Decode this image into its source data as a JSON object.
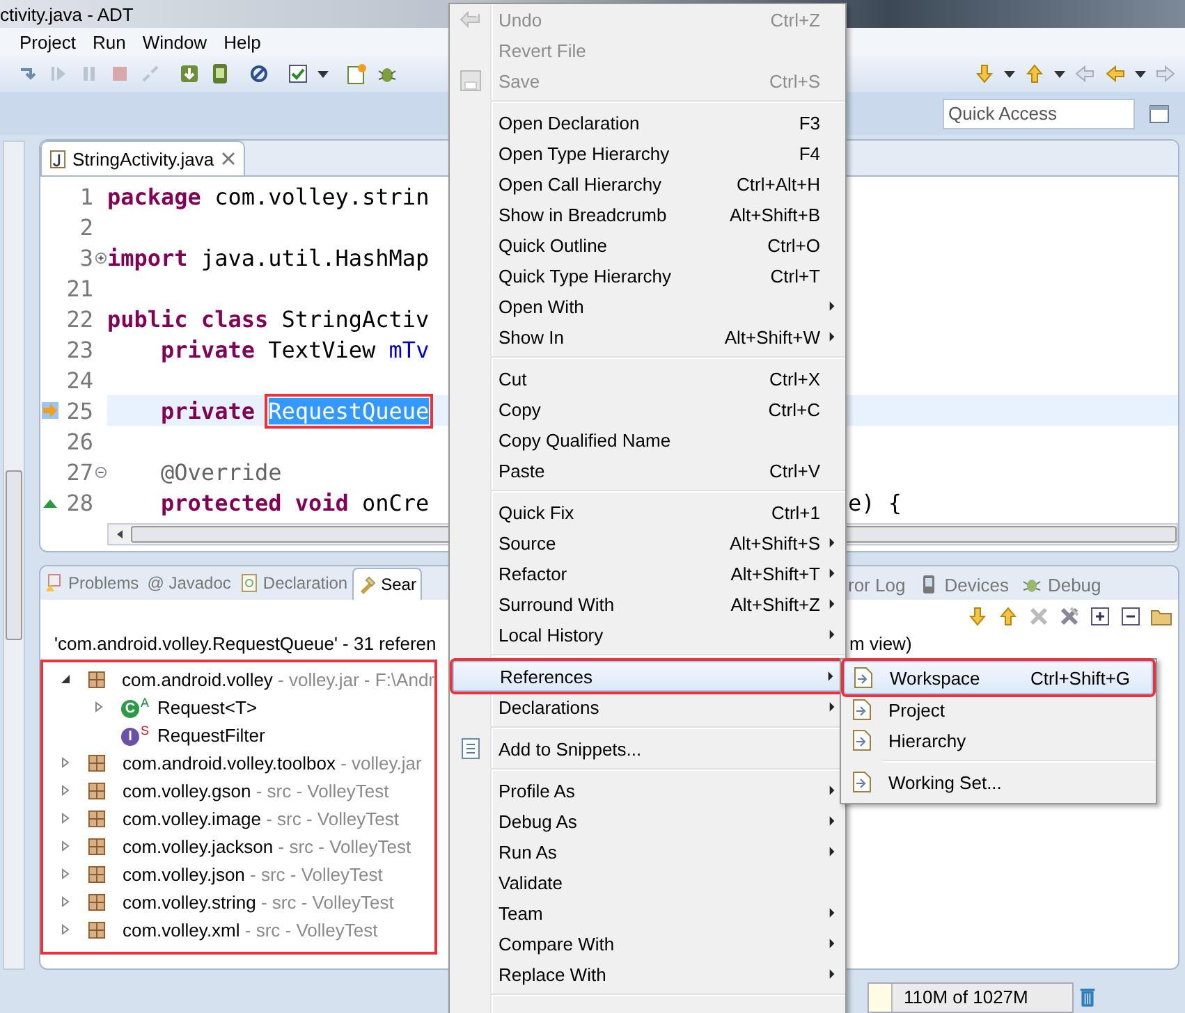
{
  "window": {
    "title": "ctivity.java - ADT"
  },
  "menubar": [
    "Project",
    "Run",
    "Window",
    "Help"
  ],
  "quick_access": {
    "placeholder": "Quick Access"
  },
  "editor": {
    "tab": {
      "label": "StringActivity.java",
      "selected": true
    },
    "lines": [
      {
        "number": "1",
        "tokens": [
          {
            "kind": "keyword",
            "text": "package"
          },
          {
            "kind": "plain",
            "text": " com.volley.strin"
          }
        ]
      },
      {
        "number": "2"
      },
      {
        "number": "3",
        "collapsed": true,
        "tokens": [
          {
            "kind": "keyword",
            "text": "import"
          },
          {
            "kind": "plain",
            "text": " java.util.HashMap"
          }
        ]
      },
      {
        "number": "21"
      },
      {
        "number": "22",
        "tokens": [
          {
            "kind": "keyword",
            "text": "public class"
          },
          {
            "kind": "plain",
            "text": " StringActiv"
          }
        ]
      },
      {
        "number": "23",
        "indent": true,
        "tokens": [
          {
            "kind": "keyword",
            "text": "private"
          },
          {
            "kind": "plain",
            "text": " TextView "
          },
          {
            "kind": "field",
            "text": "mTv"
          }
        ]
      },
      {
        "number": "24"
      },
      {
        "number": "25",
        "current": true,
        "indent": true,
        "tokens": [
          {
            "kind": "keyword",
            "text": "private"
          },
          {
            "kind": "selection",
            "text": "RequestQueue"
          }
        ]
      },
      {
        "number": "26"
      },
      {
        "number": "27",
        "collapsed": false,
        "indent": true,
        "tokens": [
          {
            "kind": "annotation",
            "text": "@Override"
          }
        ]
      },
      {
        "number": "28",
        "override": true,
        "indent": true,
        "tokens": [
          {
            "kind": "keyword",
            "text": "protected void"
          },
          {
            "kind": "plain",
            "text": " onCre"
          }
        ],
        "tail": "e) {"
      }
    ]
  },
  "bottom_panel": {
    "tabs": [
      {
        "label": "Problems",
        "selected": false
      },
      {
        "label": "@ Javadoc",
        "selected": false
      },
      {
        "label": "Declaration",
        "selected": false
      },
      {
        "label": "Sear",
        "selected": true
      }
    ],
    "tabs_right": [
      {
        "label": "ror Log",
        "selected": false
      },
      {
        "label": "Devices",
        "selected": false
      },
      {
        "label": "Debug",
        "selected": false
      }
    ],
    "header": "'com.android.volley.RequestQueue' - 31 referen",
    "header_right": "m view)",
    "tree": [
      {
        "kind": "package",
        "label": "com.android.volley",
        "detail": " - volley.jar - F:\\Andr",
        "expanded": true,
        "children": [
          {
            "kind": "class",
            "letter": "C",
            "badge": "A",
            "label": "Request<T>",
            "expanded": false
          },
          {
            "kind": "interface",
            "letter": "I",
            "badge": "S",
            "label": "RequestFilter"
          }
        ]
      },
      {
        "kind": "package",
        "label": "com.android.volley.toolbox",
        "detail": " - volley.jar",
        "expanded": false
      },
      {
        "kind": "package",
        "label": "com.volley.gson",
        "detail": " - src - VolleyTest",
        "expanded": false
      },
      {
        "kind": "package",
        "label": "com.volley.image",
        "detail": " - src - VolleyTest",
        "expanded": false
      },
      {
        "kind": "package",
        "label": "com.volley.jackson",
        "detail": " - src - VolleyTest",
        "expanded": false
      },
      {
        "kind": "package",
        "label": "com.volley.json",
        "detail": " - src - VolleyTest",
        "expanded": false
      },
      {
        "kind": "package",
        "label": "com.volley.string",
        "detail": " - src - VolleyTest",
        "expanded": false
      },
      {
        "kind": "package",
        "label": "com.volley.xml",
        "detail": " - src - VolleyTest",
        "expanded": false
      }
    ]
  },
  "context_menu": [
    {
      "kind": "item",
      "label": "Undo",
      "shortcut": "Ctrl+Z",
      "disabled": true,
      "submenu": false,
      "selected": false,
      "icon": true
    },
    {
      "kind": "item",
      "label": "Revert File",
      "disabled": true,
      "submenu": false,
      "selected": false
    },
    {
      "kind": "item",
      "label": "Save",
      "shortcut": "Ctrl+S",
      "disabled": true,
      "submenu": false,
      "selected": false,
      "icon": true
    },
    {
      "kind": "separator"
    },
    {
      "kind": "item",
      "label": "Open Declaration",
      "shortcut": "F3",
      "disabled": false,
      "submenu": false,
      "selected": false
    },
    {
      "kind": "item",
      "label": "Open Type Hierarchy",
      "shortcut": "F4",
      "disabled": false,
      "submenu": false,
      "selected": false
    },
    {
      "kind": "item",
      "label": "Open Call Hierarchy",
      "shortcut": "Ctrl+Alt+H",
      "disabled": false,
      "submenu": false,
      "selected": false
    },
    {
      "kind": "item",
      "label": "Show in Breadcrumb",
      "shortcut": "Alt+Shift+B",
      "disabled": false,
      "submenu": false,
      "selected": false
    },
    {
      "kind": "item",
      "label": "Quick Outline",
      "shortcut": "Ctrl+O",
      "disabled": false,
      "submenu": false,
      "selected": false
    },
    {
      "kind": "item",
      "label": "Quick Type Hierarchy",
      "shortcut": "Ctrl+T",
      "disabled": false,
      "submenu": false,
      "selected": false
    },
    {
      "kind": "item",
      "label": "Open With",
      "disabled": false,
      "submenu": true,
      "selected": false
    },
    {
      "kind": "item",
      "label": "Show In",
      "shortcut": "Alt+Shift+W",
      "disabled": false,
      "submenu": true,
      "selected": false
    },
    {
      "kind": "separator"
    },
    {
      "kind": "item",
      "label": "Cut",
      "shortcut": "Ctrl+X",
      "disabled": false,
      "submenu": false,
      "selected": false
    },
    {
      "kind": "item",
      "label": "Copy",
      "shortcut": "Ctrl+C",
      "disabled": false,
      "submenu": false,
      "selected": false
    },
    {
      "kind": "item",
      "label": "Copy Qualified Name",
      "disabled": false,
      "submenu": false,
      "selected": false
    },
    {
      "kind": "item",
      "label": "Paste",
      "shortcut": "Ctrl+V",
      "disabled": false,
      "submenu": false,
      "selected": false
    },
    {
      "kind": "separator"
    },
    {
      "kind": "item",
      "label": "Quick Fix",
      "shortcut": "Ctrl+1",
      "disabled": false,
      "submenu": false,
      "selected": false
    },
    {
      "kind": "item",
      "label": "Source",
      "shortcut": "Alt+Shift+S",
      "disabled": false,
      "submenu": true,
      "selected": false
    },
    {
      "kind": "item",
      "label": "Refactor",
      "shortcut": "Alt+Shift+T",
      "disabled": false,
      "submenu": true,
      "selected": false
    },
    {
      "kind": "item",
      "label": "Surround With",
      "shortcut": "Alt+Shift+Z",
      "disabled": false,
      "submenu": true,
      "selected": false
    },
    {
      "kind": "item",
      "label": "Local History",
      "disabled": false,
      "submenu": true,
      "selected": false
    },
    {
      "kind": "separator"
    },
    {
      "kind": "item",
      "label": "References",
      "disabled": false,
      "submenu": true,
      "selected": true
    },
    {
      "kind": "item",
      "label": "Declarations",
      "disabled": false,
      "submenu": true,
      "selected": false
    },
    {
      "kind": "separator"
    },
    {
      "kind": "item",
      "label": "Add to Snippets...",
      "disabled": false,
      "submenu": false,
      "selected": false,
      "icon": true
    },
    {
      "kind": "separator"
    },
    {
      "kind": "item",
      "label": "Profile As",
      "disabled": false,
      "submenu": true,
      "selected": false
    },
    {
      "kind": "item",
      "label": "Debug As",
      "disabled": false,
      "submenu": true,
      "selected": false
    },
    {
      "kind": "item",
      "label": "Run As",
      "disabled": false,
      "submenu": true,
      "selected": false
    },
    {
      "kind": "item",
      "label": "Validate",
      "disabled": false,
      "submenu": false,
      "selected": false
    },
    {
      "kind": "item",
      "label": "Team",
      "disabled": false,
      "submenu": true,
      "selected": false
    },
    {
      "kind": "item",
      "label": "Compare With",
      "disabled": false,
      "submenu": true,
      "selected": false
    },
    {
      "kind": "item",
      "label": "Replace With",
      "disabled": false,
      "submenu": true,
      "selected": false
    },
    {
      "kind": "separator"
    }
  ],
  "submenu": [
    {
      "kind": "item",
      "label": "Workspace",
      "shortcut": "Ctrl+Shift+G",
      "selected": true
    },
    {
      "kind": "item",
      "label": "Project",
      "selected": false
    },
    {
      "kind": "item",
      "label": "Hierarchy",
      "selected": false
    },
    {
      "kind": "separator"
    },
    {
      "kind": "item",
      "label": "Working Set...",
      "selected": false
    }
  ],
  "status_bar": {
    "memory": "110M of 1027M"
  }
}
